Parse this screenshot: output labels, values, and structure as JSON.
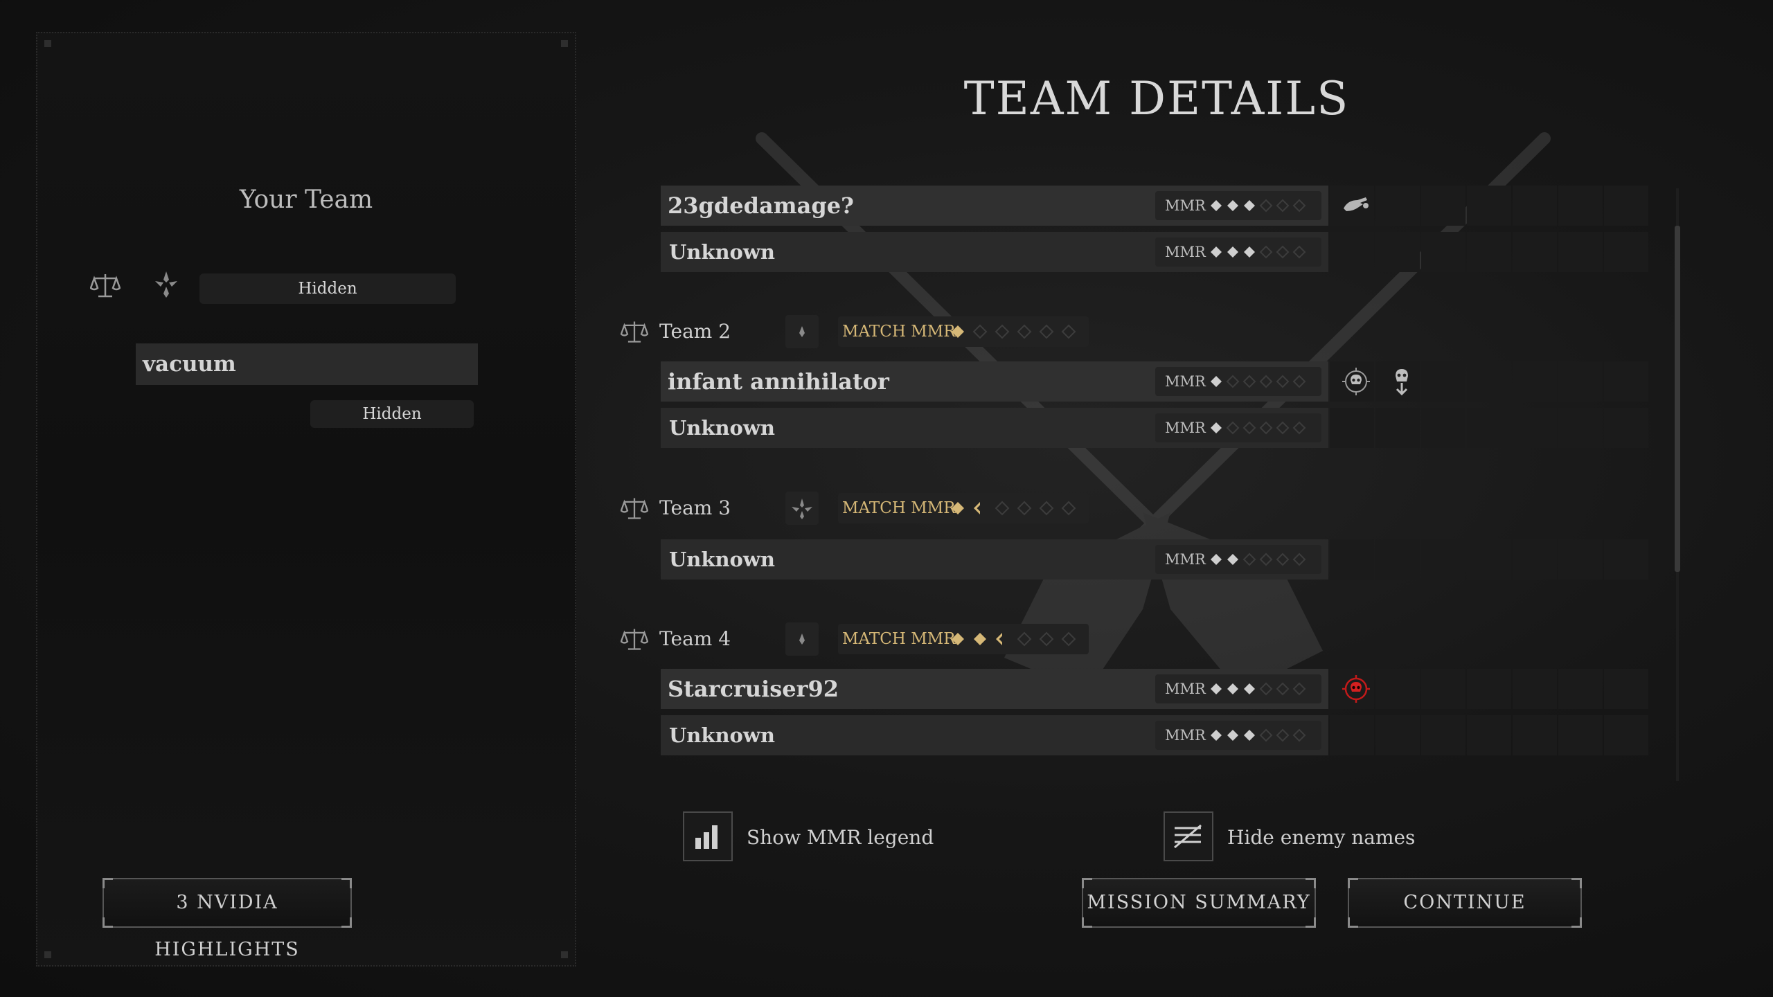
{
  "page_title": "TEAM DETAILS",
  "left_panel": {
    "title": "Your Team",
    "team_mmr_text": "Hidden",
    "player": {
      "name": "vacuum",
      "mmr_text": "Hidden"
    },
    "highlights_button": "3 NVIDIA HIGHLIGHTS"
  },
  "mmr_label": "MMR",
  "match_mmr_label": "MATCH MMR",
  "teams": [
    {
      "players": [
        {
          "name": "23gdedamage?",
          "mmr_stars": 3,
          "icons": [
            "hand-reach-icon"
          ]
        },
        {
          "name": "Unknown",
          "mmr_stars": 3,
          "icons": []
        }
      ]
    },
    {
      "label": "Team 2",
      "match_mmr_stars": 1,
      "players": [
        {
          "name": "infant annihilator",
          "mmr_stars": 1,
          "icons": [
            "skull-crosshair-icon",
            "skull-down-icon"
          ]
        },
        {
          "name": "Unknown",
          "mmr_stars": 1,
          "icons": []
        }
      ]
    },
    {
      "label": "Team 3",
      "match_mmr_stars": 1.5,
      "players": [
        {
          "name": "Unknown",
          "mmr_stars": 2,
          "icons": []
        }
      ]
    },
    {
      "label": "Team 4",
      "match_mmr_stars": 2.5,
      "players": [
        {
          "name": "Starcruiser92",
          "mmr_stars": 3,
          "icons": [
            "red-skull-crosshair-icon"
          ]
        },
        {
          "name": "Unknown",
          "mmr_stars": 3,
          "icons": []
        }
      ]
    }
  ],
  "toggles": {
    "mmr_legend": "Show MMR legend",
    "hide_names": "Hide enemy names"
  },
  "buttons": {
    "mission_summary": "MISSION SUMMARY",
    "continue": "CONTINUE"
  },
  "colors": {
    "gold": "#d6b877",
    "star_grey": "#cfcfcf",
    "star_empty": "#3c3c3c",
    "danger_red": "#c21a1a"
  }
}
